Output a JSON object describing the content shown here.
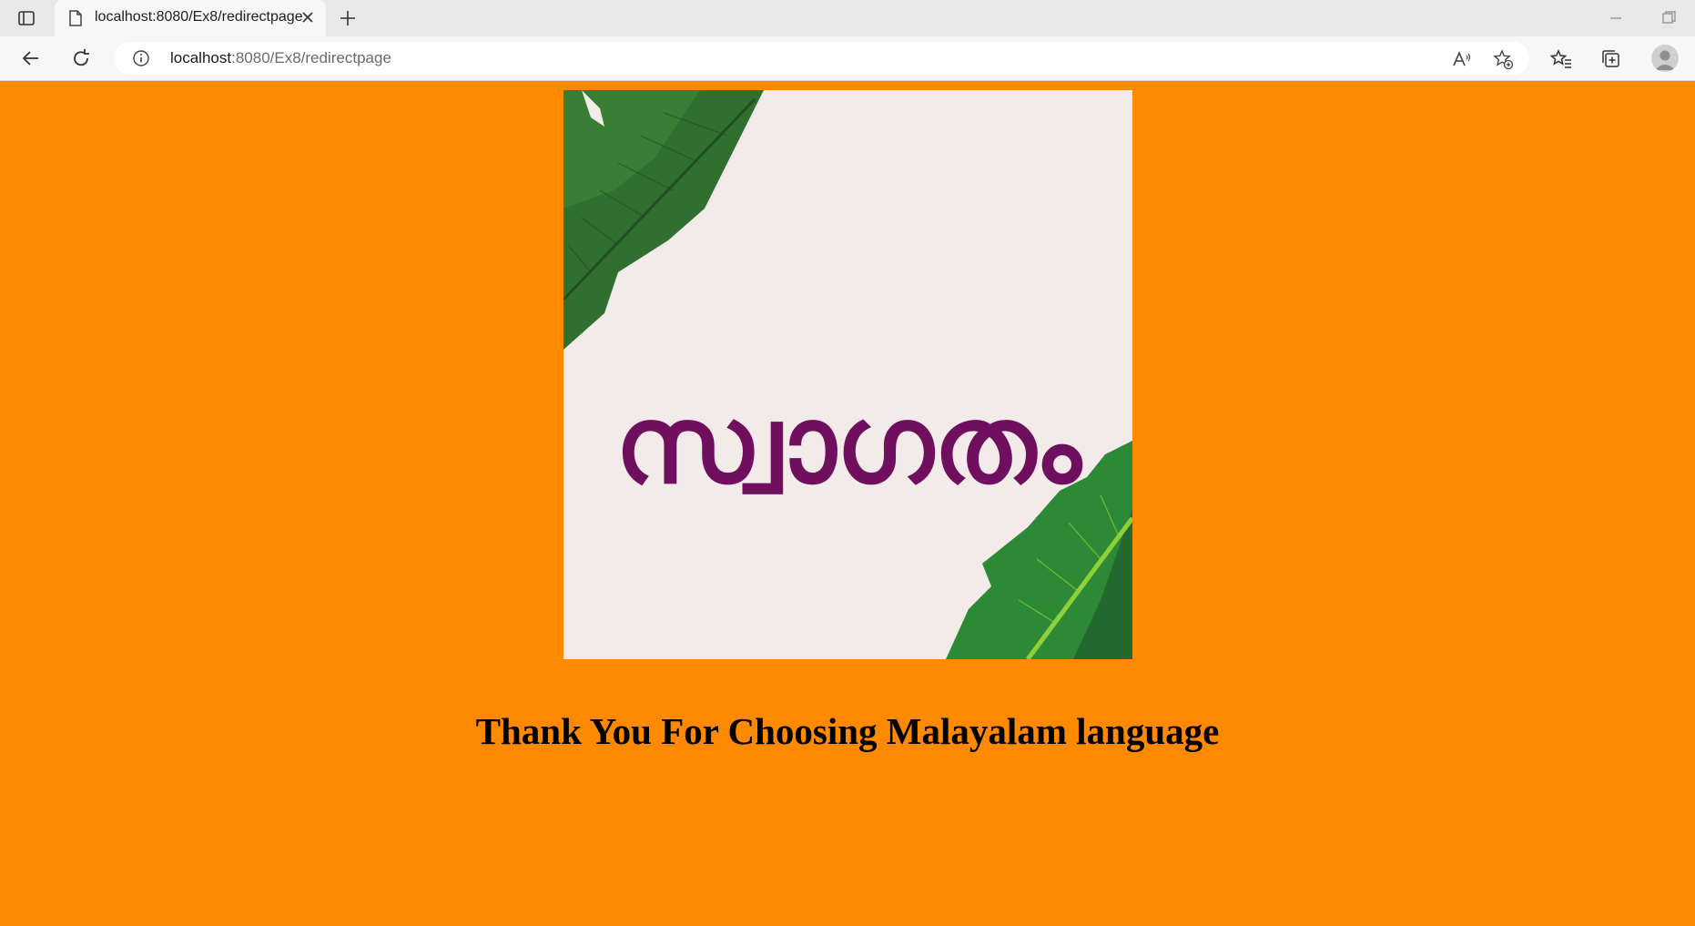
{
  "browser": {
    "tab_title": "localhost:8080/Ex8/redirectpage",
    "url_host": "localhost",
    "url_rest": ":8080/Ex8/redirectpage",
    "icons": [
      "tab-actions-icon",
      "page-icon",
      "close-icon",
      "plus-icon",
      "minimize-icon",
      "restore-icon",
      "back-arrow-icon",
      "refresh-icon",
      "info-icon",
      "read-aloud-icon",
      "add-favorite-icon",
      "favorites-icon",
      "collections-icon",
      "profile-avatar"
    ]
  },
  "page": {
    "background": "#ff8a00",
    "image": {
      "word": "സ്വാഗതം",
      "word_color": "#6f0f5e",
      "background": "#f3ebe9"
    },
    "heading": "Thank You For Choosing Malayalam language"
  }
}
